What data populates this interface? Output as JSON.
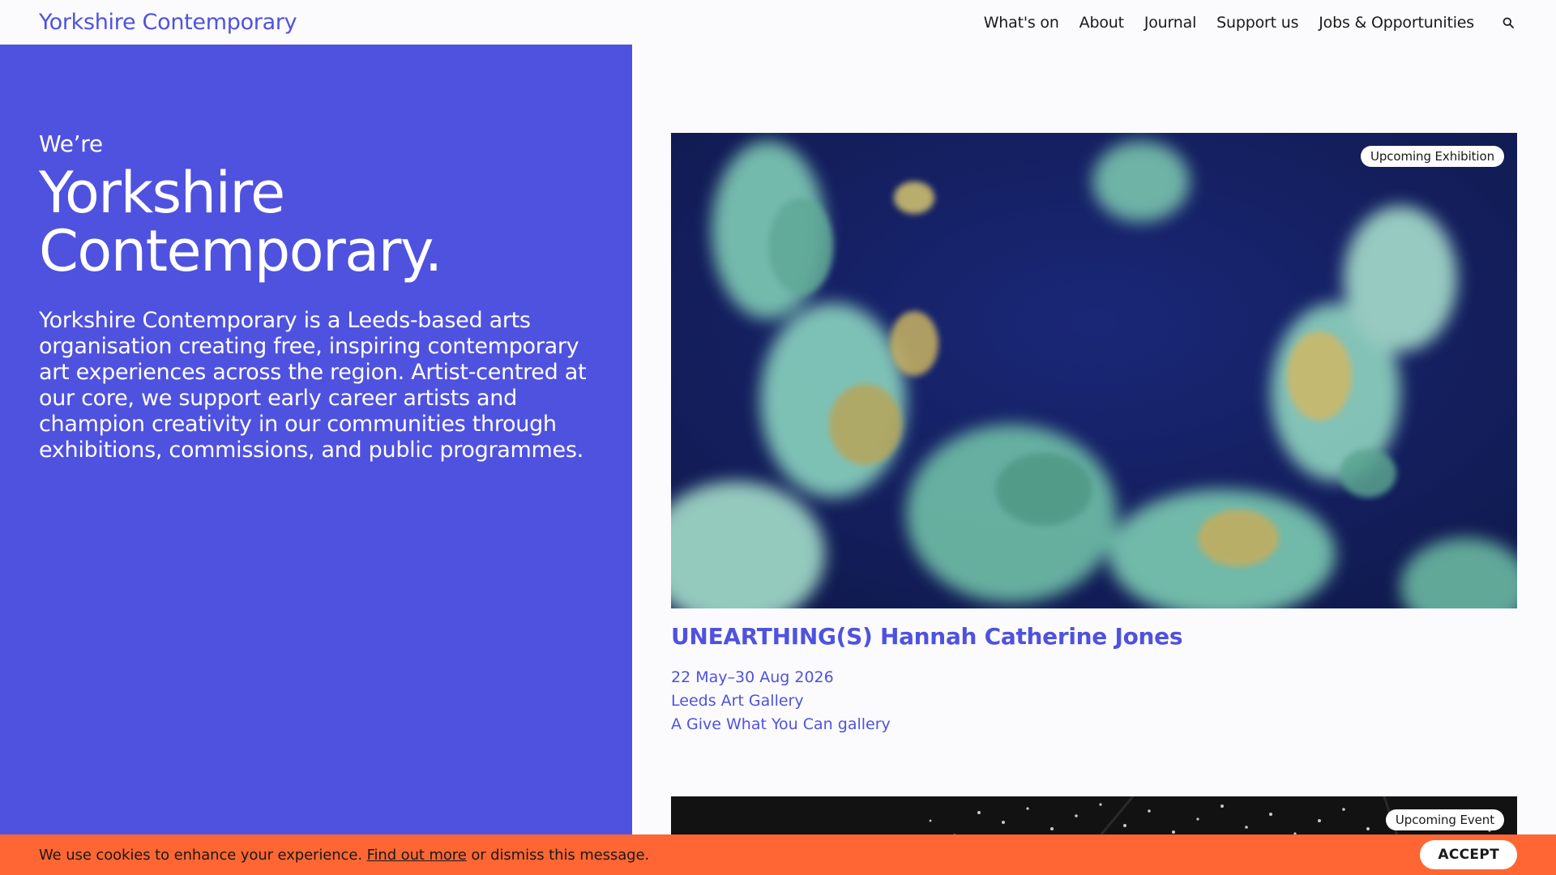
{
  "header": {
    "logo": "Yorkshire Contemporary",
    "nav": [
      "What's on",
      "About",
      "Journal",
      "Support us",
      "Jobs & Opportunities"
    ],
    "search_icon": "search-icon"
  },
  "intro": {
    "kicker": "We’re",
    "title_line1": "Yorkshire",
    "title_line2": "Contemporary.",
    "body": "Yorkshire Contemporary is a Leeds-based arts organisation creating free, inspiring contemporary art experiences across the region. Artist-centred at our core, we support early career artists and champion creativity in our communities through exhibitions, commissions, and public programmes."
  },
  "cards": [
    {
      "badge": "Upcoming Exhibition",
      "title": "UNEARTHING(S) Hannah Catherine Jones",
      "dates": "22 May–30 Aug 2026",
      "venue": "Leeds Art Gallery",
      "note": "A Give What You Can gallery"
    },
    {
      "badge": "Upcoming Event"
    }
  ],
  "cookie": {
    "text_before": "We use cookies to enhance your experience.",
    "link": "Find out more",
    "text_after": "or dismiss this message.",
    "accept": "ACCEPT"
  },
  "colors": {
    "brand": "#4f52df",
    "cookie_bar": "#ff6633",
    "background": "#fbfbfd"
  }
}
